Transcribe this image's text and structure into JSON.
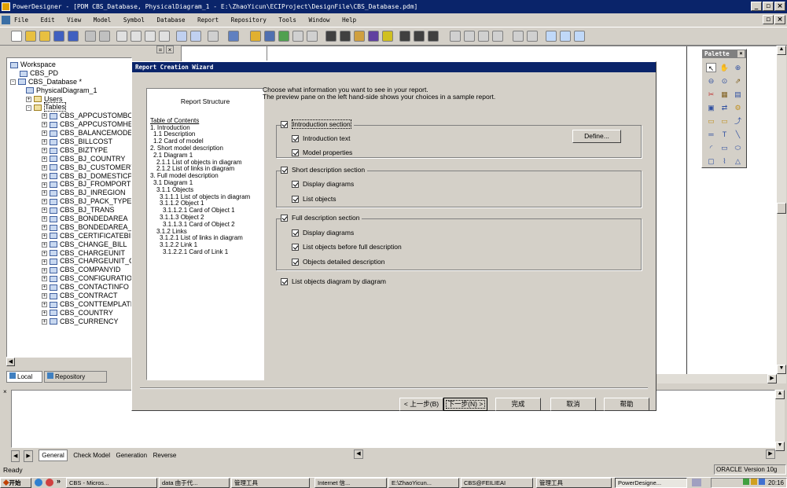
{
  "window": {
    "title": "PowerDesigner - [PDM CBS_Database, PhysicalDiagram_1 - E:\\ZhaoYicun\\ECIProject\\DesignFile\\CBS_Database.pdm]"
  },
  "menu": [
    "File",
    "Edit",
    "View",
    "Model",
    "Symbol",
    "Database",
    "Report",
    "Repository",
    "Tools",
    "Window",
    "Help"
  ],
  "tree": {
    "root": "Workspace",
    "project": "CBS_PD",
    "model": "CBS_Database *",
    "diagram": "PhysicalDiagram_1",
    "users": "Users",
    "tables": "Tables",
    "table_items": [
      "CBS_APPCUSTOMBODY",
      "CBS_APPCUSTOMHEAD",
      "CBS_BALANCEMODE",
      "CBS_BILLCOST",
      "CBS_BIZTYPE",
      "CBS_BJ_COUNTRY",
      "CBS_BJ_CUSTOMERTY",
      "CBS_BJ_DOMESTICPOI",
      "CBS_BJ_FROMPORT",
      "CBS_BJ_INREGION",
      "CBS_BJ_PACK_TYPE",
      "CBS_BJ_TRANS",
      "CBS_BONDEDAREA",
      "CBS_BONDEDAREA_IN",
      "CBS_CERTIFICATEBILL",
      "CBS_CHANGE_BILL",
      "CBS_CHARGEUNIT",
      "CBS_CHARGEUNIT_CO",
      "CBS_COMPANYID",
      "CBS_CONFIGURATION",
      "CBS_CONTACTINFO",
      "CBS_CONTRACT",
      "CBS_CONTTEMPLATE",
      "CBS_COUNTRY",
      "CBS_CURRENCY"
    ]
  },
  "browser_tabs": [
    "Local",
    "Repository"
  ],
  "dialog": {
    "title": "Report Creation Wizard",
    "instructions": [
      "Choose what information you want to see in your report.",
      "The preview pane on the left hand-side shows your choices in a sample report."
    ],
    "preview": {
      "title": "Report Structure",
      "lines": [
        "Table of Contents",
        "1. Introduction",
        "  1.1 Description",
        "  1.2 Card of model",
        "2. Short model description",
        "  2.1 Diagram 1",
        "    2.1.1 List of objects in diagram",
        "    2.1.2 List of links in diagram",
        "3. Full model description",
        "  3.1 Diagram 1",
        "    3.1.1 Objects",
        "      3.1.1.1 List of objects in diagram",
        "      3.1.1.2 Object 1",
        "        3.1.1.2.1 Card of Object 1",
        "      3.1.1.3 Object 2",
        "        3.1.1.3.1 Card of Object 2",
        "    3.1.2 Links",
        "      3.1.2.1 List of links in diagram",
        "      3.1.2.2 Link 1",
        "        3.1.2.2.1 Card of Link 1"
      ]
    },
    "intro": {
      "label": "Introduction section",
      "text": "Introduction text",
      "props": "Model properties",
      "define": "Define..."
    },
    "short": {
      "label": "Short description section",
      "diagrams": "Display diagrams",
      "objects": "List objects"
    },
    "full": {
      "label": "Full description section",
      "diagrams": "Display diagrams",
      "before": "List objects before full description",
      "detailed": "Objects detailed description"
    },
    "bydiagram": "List objects diagram by diagram",
    "buttons": {
      "back": "< 上一步(B)",
      "next": "下一步(N) >",
      "finish": "完成",
      "cancel": "取消",
      "help": "帮助"
    }
  },
  "palette": {
    "title": "Palette"
  },
  "output_tabs": [
    "General",
    "Check Model",
    "Generation",
    "Reverse"
  ],
  "status": {
    "left": "Ready",
    "right": "ORACLE Version 10g"
  },
  "taskbar": {
    "start": "开始",
    "items": [
      "CBS - Micros...",
      "data 由于代...",
      "管理工具",
      "Internet 信...",
      "E:\\ZhaoYicun...",
      "CBS@FEILIEAI",
      "管理工具",
      "PowerDesigne..."
    ],
    "clock": "20:16"
  }
}
